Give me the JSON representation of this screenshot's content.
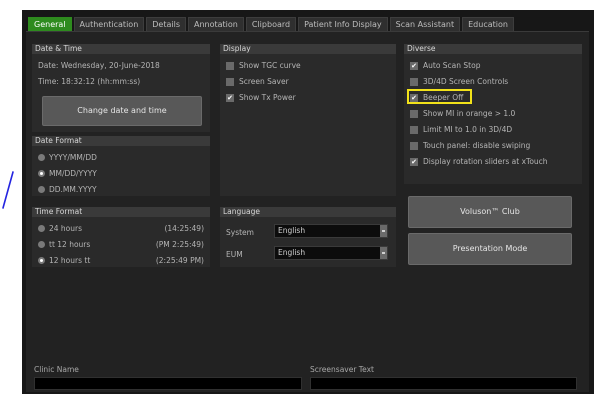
{
  "tabs": [
    {
      "label": "General",
      "active": true
    },
    {
      "label": "Authentication",
      "active": false
    },
    {
      "label": "Details",
      "active": false
    },
    {
      "label": "Annotation",
      "active": false
    },
    {
      "label": "Clipboard",
      "active": false
    },
    {
      "label": "Patient Info Display",
      "active": false
    },
    {
      "label": "Scan Assistant",
      "active": false
    },
    {
      "label": "Education",
      "active": false
    }
  ],
  "date_time": {
    "title": "Date & Time",
    "date_line": "Date:  Wednesday, 20-June-2018",
    "time_line": "Time:  18:32:12 (hh:mm:ss)",
    "change_button": "Change date and time"
  },
  "date_format": {
    "title": "Date Format",
    "options": [
      {
        "label": "YYYY/MM/DD",
        "selected": false
      },
      {
        "label": "MM/DD/YYYY",
        "selected": true
      },
      {
        "label": "DD.MM.YYYY",
        "selected": false
      }
    ]
  },
  "time_format": {
    "title": "Time Format",
    "options": [
      {
        "label": "24 hours",
        "example": "(14:25:49)",
        "selected": false
      },
      {
        "label": "tt 12 hours",
        "example": "(PM 2:25:49)",
        "selected": false
      },
      {
        "label": "12 hours tt",
        "example": "(2:25:49 PM)",
        "selected": true
      }
    ]
  },
  "display": {
    "title": "Display",
    "items": [
      {
        "label": "Show TGC curve",
        "checked": false
      },
      {
        "label": "Screen Saver",
        "checked": false
      },
      {
        "label": "Show Tx Power",
        "checked": true
      }
    ]
  },
  "language": {
    "title": "Language",
    "system_label": "System",
    "system_value": "English",
    "eum_label": "EUM",
    "eum_value": "English"
  },
  "diverse": {
    "title": "Diverse",
    "items": [
      {
        "label": "Auto Scan Stop",
        "checked": true
      },
      {
        "label": "3D/4D Screen Controls",
        "checked": false
      },
      {
        "label": "Beeper Off",
        "checked": true
      },
      {
        "label": "Show MI in orange > 1.0",
        "checked": false
      },
      {
        "label": "Limit MI to 1.0 in 3D/4D",
        "checked": false
      },
      {
        "label": "Touch panel: disable swiping",
        "checked": false
      },
      {
        "label": "Display rotation sliders at xTouch",
        "checked": true
      }
    ]
  },
  "buttons": {
    "voluson_club": "Voluson™ Club",
    "presentation_mode": "Presentation Mode"
  },
  "bottom": {
    "clinic_label": "Clinic Name",
    "clinic_value": "",
    "screensaver_label": "Screensaver Text",
    "screensaver_value": ""
  },
  "colors": {
    "accent": "#2e8b1e",
    "highlight": "#f2e21a",
    "stroke": "#2424e0"
  }
}
